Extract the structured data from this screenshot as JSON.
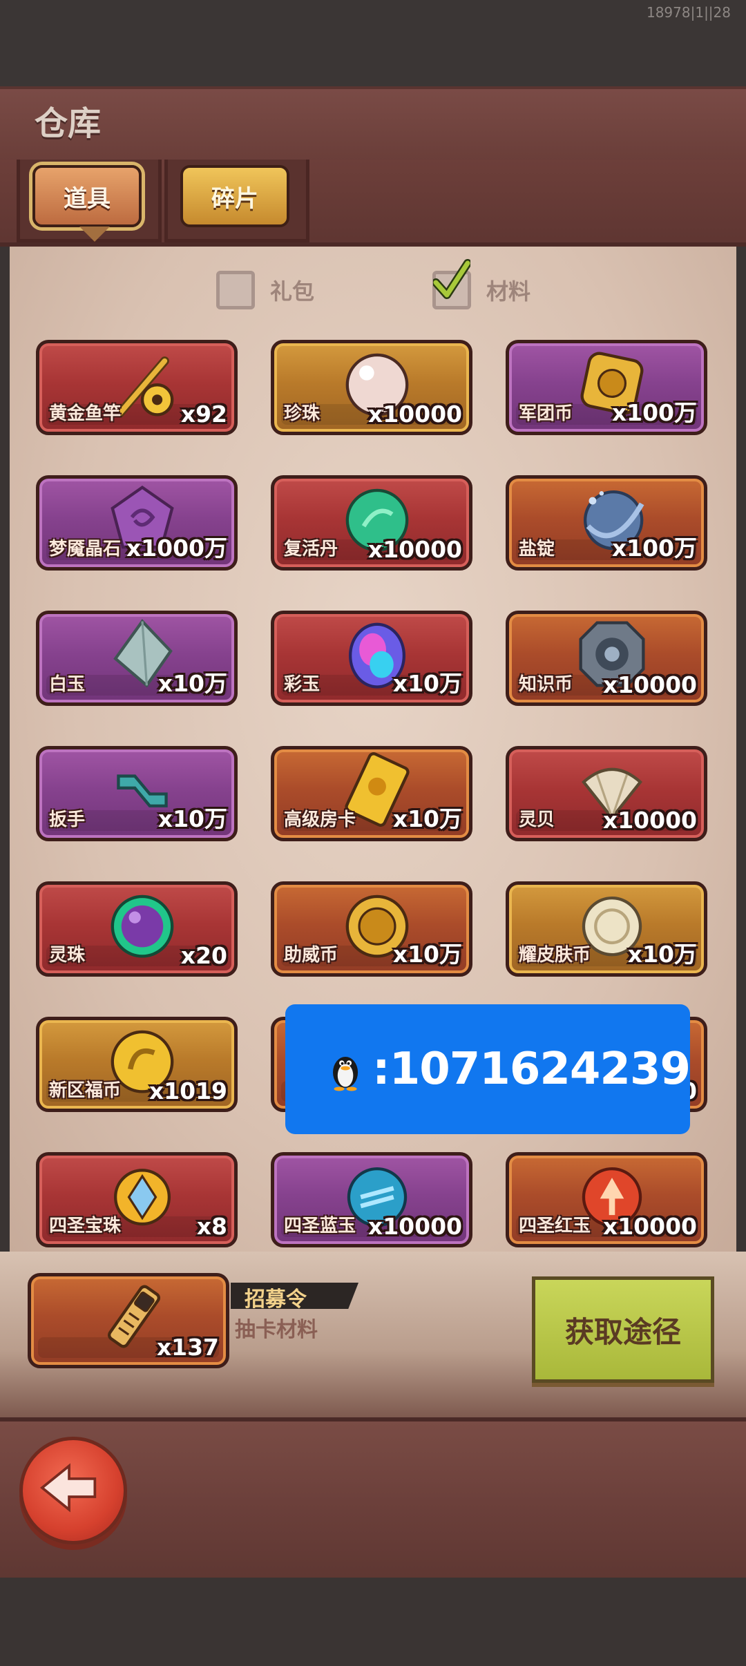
{
  "status": {
    "text": "18978|1||28"
  },
  "header": {
    "title": "仓库"
  },
  "tabs": [
    {
      "label": "道具"
    },
    {
      "label": "碎片"
    }
  ],
  "filters": [
    {
      "label": "礼包",
      "checked": false
    },
    {
      "label": "材料",
      "checked": true
    }
  ],
  "items": [
    {
      "name": "黄金鱼竿",
      "count": "x92",
      "color": "red",
      "icon": "golden-fishing-rod-icon"
    },
    {
      "name": "珍珠",
      "count": "x10000",
      "color": "gold",
      "icon": "pearl-icon"
    },
    {
      "name": "军团币",
      "count": "x100万",
      "color": "purple",
      "icon": "legion-coin-icon"
    },
    {
      "name": "梦魇晶石",
      "count": "x1000万",
      "color": "purple",
      "icon": "nightmare-crystal-icon"
    },
    {
      "name": "复活丹",
      "count": "x10000",
      "color": "red",
      "icon": "revive-pill-icon"
    },
    {
      "name": "盐锭",
      "count": "x100万",
      "color": "orange",
      "icon": "salt-ingot-icon"
    },
    {
      "name": "白玉",
      "count": "x10万",
      "color": "purple",
      "icon": "white-jade-icon"
    },
    {
      "name": "彩玉",
      "count": "x10万",
      "color": "red",
      "icon": "rainbow-jade-icon"
    },
    {
      "name": "知识币",
      "count": "x10000",
      "color": "orange",
      "icon": "knowledge-coin-icon"
    },
    {
      "name": "扳手",
      "count": "x10万",
      "color": "purple",
      "icon": "wrench-icon"
    },
    {
      "name": "高级房卡",
      "count": "x10万",
      "color": "orange",
      "icon": "premium-room-card-icon"
    },
    {
      "name": "灵贝",
      "count": "x10000",
      "color": "red",
      "icon": "spirit-shell-icon"
    },
    {
      "name": "灵珠",
      "count": "x20",
      "color": "red",
      "icon": "spirit-orb-icon"
    },
    {
      "name": "助威币",
      "count": "x10万",
      "color": "orange",
      "icon": "cheer-coin-icon"
    },
    {
      "name": "耀皮肤币",
      "count": "x10万",
      "color": "gold",
      "icon": "skin-coin-icon"
    },
    {
      "name": "新区福币",
      "count": "x1019",
      "color": "gold",
      "icon": "new-server-coin-icon"
    },
    {
      "name": "",
      "count": "",
      "color": "orange",
      "icon": "hidden-item-icon"
    },
    {
      "name": "",
      "count": "0",
      "color": "orange",
      "icon": "hidden-item-icon"
    },
    {
      "name": "四圣宝珠",
      "count": "x8",
      "color": "red",
      "icon": "four-saints-orb-icon"
    },
    {
      "name": "四圣蓝玉",
      "count": "x10000",
      "color": "purple",
      "icon": "four-saints-blue-jade-icon"
    },
    {
      "name": "四圣红玉",
      "count": "x10000",
      "color": "orange",
      "icon": "four-saints-red-jade-icon"
    }
  ],
  "overlay": {
    "text": ":1071624239",
    "icon": "penguin-icon",
    "color": "#1177ef"
  },
  "selected": {
    "count": "x137",
    "label": "招募令",
    "description": "抽卡材料",
    "icon": "recruit-token-icon"
  },
  "actions": {
    "get_path": "获取途径",
    "back_icon": "back-arrow-icon"
  }
}
